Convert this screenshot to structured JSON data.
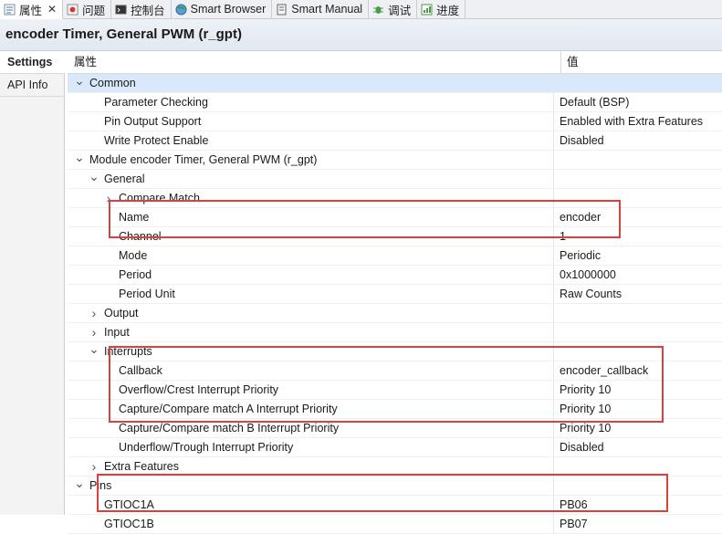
{
  "tabs": [
    {
      "label": "属性",
      "icon": "properties-icon",
      "active": true,
      "closable": true
    },
    {
      "label": "问题",
      "icon": "problems-icon"
    },
    {
      "label": "控制台",
      "icon": "console-icon"
    },
    {
      "label": "Smart Browser",
      "icon": "smart-browser-icon"
    },
    {
      "label": "Smart Manual",
      "icon": "smart-manual-icon"
    },
    {
      "label": "调试",
      "icon": "debug-icon"
    },
    {
      "label": "进度",
      "icon": "progress-icon"
    }
  ],
  "header": {
    "title": "encoder Timer, General PWM (r_gpt)"
  },
  "left_tabs": [
    "Settings",
    "API Info"
  ],
  "columns": {
    "property": "属性",
    "value": "值"
  },
  "rows": [
    {
      "label": "Common",
      "value": "",
      "twisty": "down"
    },
    {
      "label": "Parameter Checking",
      "value": "Default (BSP)"
    },
    {
      "label": "Pin Output Support",
      "value": "Enabled with Extra Features"
    },
    {
      "label": "Write Protect Enable",
      "value": "Disabled"
    },
    {
      "label": "Module encoder Timer, General PWM (r_gpt)",
      "value": "",
      "twisty": "down"
    },
    {
      "label": "General",
      "value": "",
      "twisty": "down"
    },
    {
      "label": "Compare Match",
      "value": "",
      "twisty": "right"
    },
    {
      "label": "Name",
      "value": "encoder"
    },
    {
      "label": "Channel",
      "value": "1"
    },
    {
      "label": "Mode",
      "value": "Periodic"
    },
    {
      "label": "Period",
      "value": "0x1000000"
    },
    {
      "label": "Period Unit",
      "value": "Raw Counts"
    },
    {
      "label": "Output",
      "value": "",
      "twisty": "right"
    },
    {
      "label": "Input",
      "value": "",
      "twisty": "right"
    },
    {
      "label": "Interrupts",
      "value": "",
      "twisty": "down"
    },
    {
      "label": "Callback",
      "value": "encoder_callback"
    },
    {
      "label": "Overflow/Crest Interrupt Priority",
      "value": "Priority 10"
    },
    {
      "label": "Capture/Compare match A Interrupt Priority",
      "value": "Priority 10"
    },
    {
      "label": "Capture/Compare match B Interrupt Priority",
      "value": "Priority 10"
    },
    {
      "label": "Underflow/Trough Interrupt Priority",
      "value": "Disabled"
    },
    {
      "label": "Extra Features",
      "value": "",
      "twisty": "right"
    },
    {
      "label": "Pins",
      "value": "",
      "twisty": "down"
    },
    {
      "label": "GTIOC1A",
      "value": "PB06"
    },
    {
      "label": "GTIOC1B",
      "value": "PB07"
    }
  ],
  "colors": {
    "highlight": "#d9413f",
    "selection": "#d9e9fb"
  }
}
